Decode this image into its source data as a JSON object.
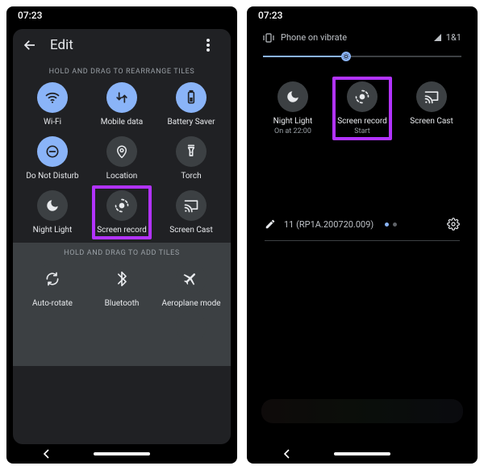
{
  "left": {
    "statusbar": {
      "time": "07:23"
    },
    "header": {
      "title": "Edit"
    },
    "hint_rearrange": "HOLD AND DRAG TO REARRANGE TILES",
    "hint_add": "HOLD AND DRAG TO ADD TILES",
    "active_tiles": [
      {
        "key": "wifi",
        "label": "Wi-Fi",
        "icon": "wifi",
        "active": true
      },
      {
        "key": "mobile-data",
        "label": "Mobile data",
        "icon": "swap",
        "active": true
      },
      {
        "key": "battery-saver",
        "label": "Battery Saver",
        "icon": "battery",
        "active": true
      },
      {
        "key": "dnd",
        "label": "Do Not Disturb",
        "icon": "dnd",
        "active": true
      },
      {
        "key": "location",
        "label": "Location",
        "icon": "location",
        "active": false
      },
      {
        "key": "torch",
        "label": "Torch",
        "icon": "torch",
        "active": false
      },
      {
        "key": "night-light",
        "label": "Night Light",
        "icon": "moon",
        "active": false
      },
      {
        "key": "screen-record",
        "label": "Screen record",
        "icon": "record",
        "active": false,
        "highlight": true
      },
      {
        "key": "screen-cast",
        "label": "Screen Cast",
        "icon": "cast",
        "active": false
      }
    ],
    "add_tiles": [
      {
        "key": "auto-rotate",
        "label": "Auto-rotate",
        "icon": "rotate"
      },
      {
        "key": "bluetooth",
        "label": "Bluetooth",
        "icon": "bluetooth"
      },
      {
        "key": "aeroplane",
        "label": "Aeroplane mode",
        "icon": "airplane"
      }
    ]
  },
  "right": {
    "statusbar": {
      "time": "07:23"
    },
    "shade": {
      "ringer": "Phone on vibrate",
      "carrier": "1&1",
      "brightness_pct": 42,
      "tiles": [
        {
          "key": "night-light",
          "label": "Night Light",
          "sublabel": "On at 22:00",
          "icon": "moon"
        },
        {
          "key": "screen-record",
          "label": "Screen record",
          "sublabel": "Start",
          "icon": "record",
          "highlight": true
        },
        {
          "key": "screen-cast",
          "label": "Screen Cast",
          "sublabel": "",
          "icon": "cast"
        }
      ],
      "build": "11 (RP1A.200720.009)",
      "page": {
        "current": 1,
        "total": 2
      }
    }
  }
}
